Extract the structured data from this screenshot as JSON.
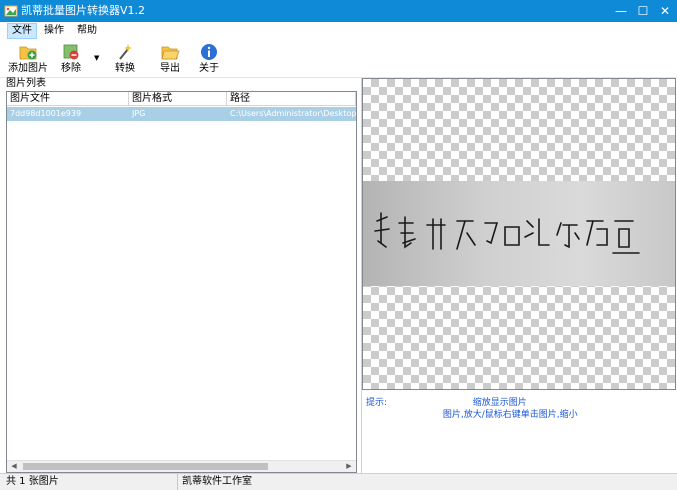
{
  "window": {
    "title": "凯蒂批量图片转换器V1.2",
    "controls": {
      "minimize": "—",
      "maximize": "☐",
      "close": "✕"
    }
  },
  "menu": [
    {
      "label": "文件",
      "active": true
    },
    {
      "label": "操作",
      "active": false
    },
    {
      "label": "帮助",
      "active": false
    }
  ],
  "toolbar": {
    "add_label": "添加图片",
    "remove_label": "移除",
    "convert_label": "转换",
    "export_label": "导出",
    "about_label": "关于"
  },
  "image_list": {
    "title": "图片列表",
    "columns": [
      "图片文件",
      "图片格式",
      "路径"
    ],
    "rows": [
      {
        "file": "7dd98d1001e939",
        "format": "JPG",
        "path": "C:\\Users\\Administrator\\Desktop\\ytc\\"
      }
    ]
  },
  "preview": {
    "hint_line1": "提示:",
    "hint_line1_tail": "缩放显示图片",
    "hint_line2": "图片,放大/鼠标右键单击图片,缩小",
    "signature_text": "就是开不了口让你知道"
  },
  "status": {
    "count": "共 1 张图片",
    "studio": "凯蒂软件工作室"
  },
  "colors": {
    "titlebar": "#0f8ad6",
    "selected_row": "#a9cfe6",
    "hint_text": "#1a56d6"
  }
}
